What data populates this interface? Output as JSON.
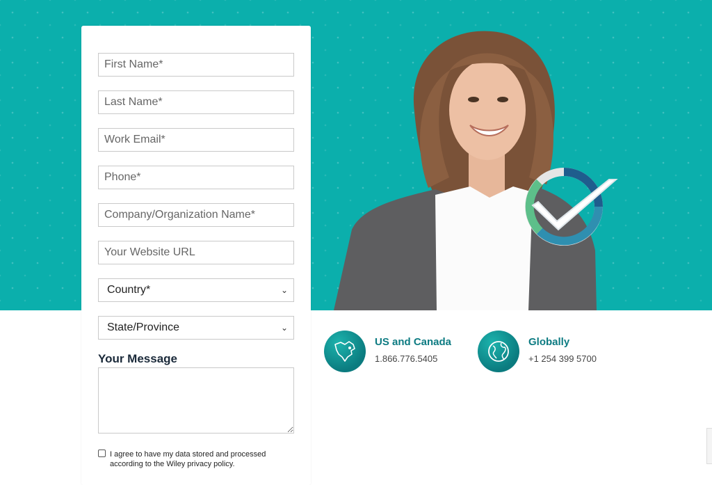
{
  "form": {
    "first_name_placeholder": "First Name*",
    "last_name_placeholder": "Last Name*",
    "work_email_placeholder": "Work Email*",
    "phone_placeholder": "Phone*",
    "company_placeholder": "Company/Organization Name*",
    "website_placeholder": "Your Website URL",
    "country_selected": "Country*",
    "state_selected": "State/Province",
    "message_label": "Your Message",
    "consent_text": "I agree to have my data stored and processed according to the Wiley privacy policy."
  },
  "contacts": [
    {
      "title": "US and Canada",
      "phone": "1.866.776.5405",
      "icon": "north-america-map-icon"
    },
    {
      "title": "Globally",
      "phone": "+1 254 399 5700",
      "icon": "globe-icon"
    }
  ],
  "colors": {
    "hero_teal": "#0bafac",
    "accent_teal": "#0d7b82",
    "check_green": "#5dbf8a"
  }
}
